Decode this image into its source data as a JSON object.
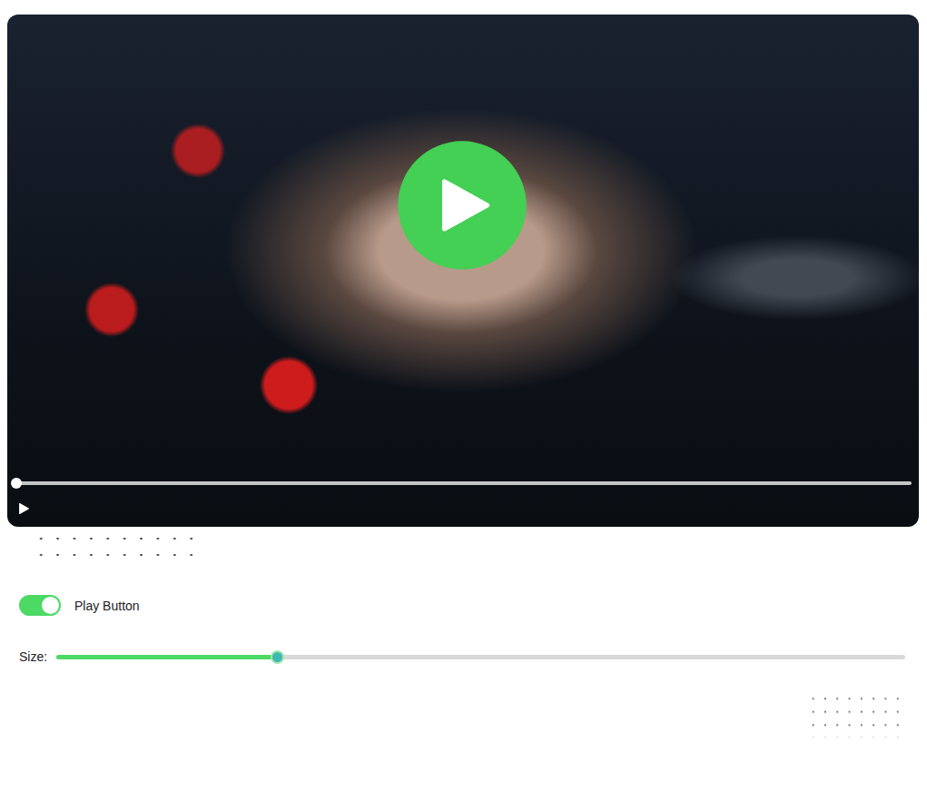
{
  "player": {
    "progress": 0,
    "playing": false
  },
  "controls": {
    "play_button": {
      "label": "Play Button",
      "on": true
    },
    "size": {
      "label": "Size:",
      "level": 0.26
    }
  }
}
